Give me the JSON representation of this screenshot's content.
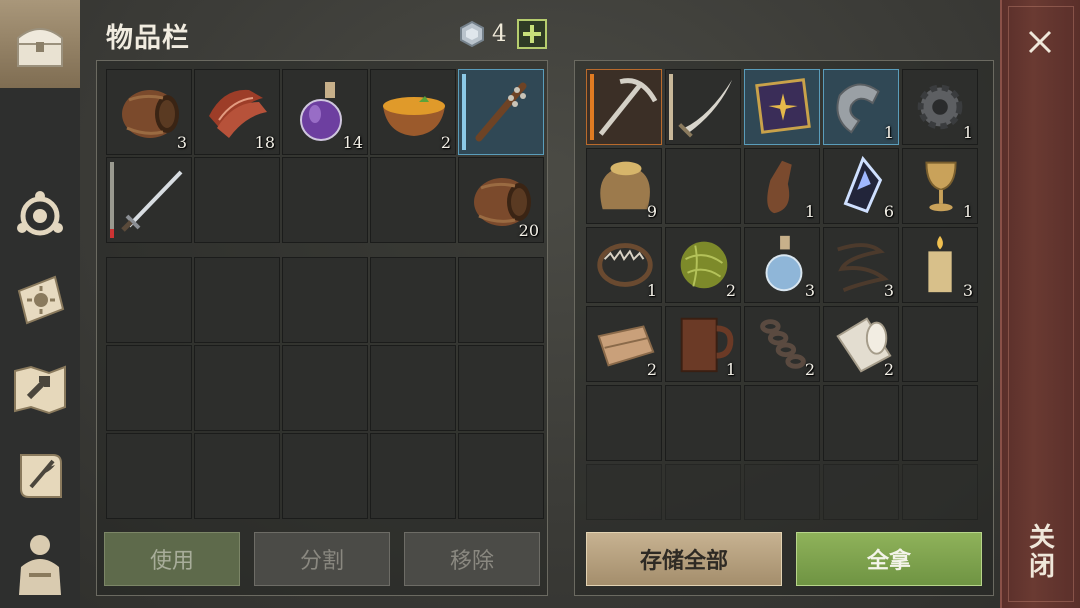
{
  "inventory": {
    "title": "物品栏",
    "currency_value": "4",
    "add_label": "+",
    "slots_top": [
      {
        "icon": "barrel-icon",
        "count": "3"
      },
      {
        "icon": "meat-strips-icon",
        "count": "18"
      },
      {
        "icon": "potion-bottle-icon",
        "count": "14"
      },
      {
        "icon": "soup-bowl-icon",
        "count": "2"
      },
      {
        "icon": "spiked-club-icon",
        "count": ""
      },
      {
        "icon": "sword-icon",
        "count": ""
      },
      {
        "icon": "empty",
        "count": ""
      },
      {
        "icon": "empty",
        "count": ""
      },
      {
        "icon": "empty",
        "count": ""
      },
      {
        "icon": "barrel-icon",
        "count": "20"
      }
    ],
    "buttons": {
      "use": "使用",
      "split": "分割",
      "remove": "移除"
    }
  },
  "storage": {
    "slots": [
      {
        "icon": "pickaxe-icon",
        "count": ""
      },
      {
        "icon": "scimitar-icon",
        "count": ""
      },
      {
        "icon": "recipe-book-icon",
        "count": ""
      },
      {
        "icon": "metal-bracket-icon",
        "count": "1"
      },
      {
        "icon": "gear-icon",
        "count": "1"
      },
      {
        "icon": "grain-sack-icon",
        "count": "9"
      },
      {
        "icon": "empty",
        "count": ""
      },
      {
        "icon": "leather-flask-icon",
        "count": "1"
      },
      {
        "icon": "crystal-shard-icon",
        "count": "6"
      },
      {
        "icon": "goblet-icon",
        "count": "1"
      },
      {
        "icon": "bear-trap-icon",
        "count": "1"
      },
      {
        "icon": "fiber-ball-icon",
        "count": "2"
      },
      {
        "icon": "water-bottle-icon",
        "count": "3"
      },
      {
        "icon": "rope-icon",
        "count": "3"
      },
      {
        "icon": "candle-icon",
        "count": "3"
      },
      {
        "icon": "cloth-icon",
        "count": "2"
      },
      {
        "icon": "tankard-icon",
        "count": "1"
      },
      {
        "icon": "chain-icon",
        "count": "2"
      },
      {
        "icon": "bandage-roll-icon",
        "count": "2"
      }
    ],
    "buttons": {
      "store_all": "存储全部",
      "take_all": "全拿"
    }
  },
  "close": {
    "label": "关闭"
  },
  "colors": {
    "accent_green": "#8fb25a",
    "highlight_blue": "#5a9dbb",
    "close_red": "#6a3a32"
  }
}
